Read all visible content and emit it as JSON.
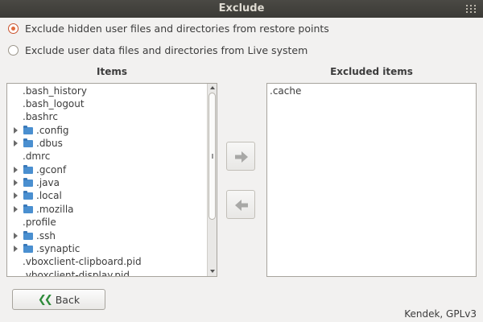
{
  "window": {
    "title": "Exclude"
  },
  "options": [
    {
      "label": "Exclude hidden user files and directories from restore points",
      "checked": true
    },
    {
      "label": "Exclude user data files and directories from Live system",
      "checked": false
    }
  ],
  "items_panel": {
    "title": "Items",
    "entries": [
      {
        "name": ".bash_history",
        "folder": false
      },
      {
        "name": ".bash_logout",
        "folder": false
      },
      {
        "name": ".bashrc",
        "folder": false
      },
      {
        "name": ".config",
        "folder": true
      },
      {
        "name": ".dbus",
        "folder": true
      },
      {
        "name": ".dmrc",
        "folder": false
      },
      {
        "name": ".gconf",
        "folder": true
      },
      {
        "name": ".java",
        "folder": true
      },
      {
        "name": ".local",
        "folder": true
      },
      {
        "name": ".mozilla",
        "folder": true
      },
      {
        "name": ".profile",
        "folder": false
      },
      {
        "name": ".ssh",
        "folder": true
      },
      {
        "name": ".synaptic",
        "folder": true
      },
      {
        "name": ".vboxclient-clipboard.pid",
        "folder": false
      },
      {
        "name": ".vboxclient-display.pid",
        "folder": false
      }
    ]
  },
  "excluded_panel": {
    "title": "Excluded items",
    "entries": [
      {
        "name": ".cache"
      }
    ]
  },
  "buttons": {
    "add_icon": "arrow-right-icon",
    "remove_icon": "arrow-left-icon",
    "back_label": "Back",
    "back_icon": "double-chevron-left-icon"
  },
  "footer": {
    "credit": "Kendek, GPLv3"
  },
  "colors": {
    "radio_accent": "#e06c3e",
    "folder": "#4a8fd0",
    "back_chevron": "#2e8b3a"
  }
}
